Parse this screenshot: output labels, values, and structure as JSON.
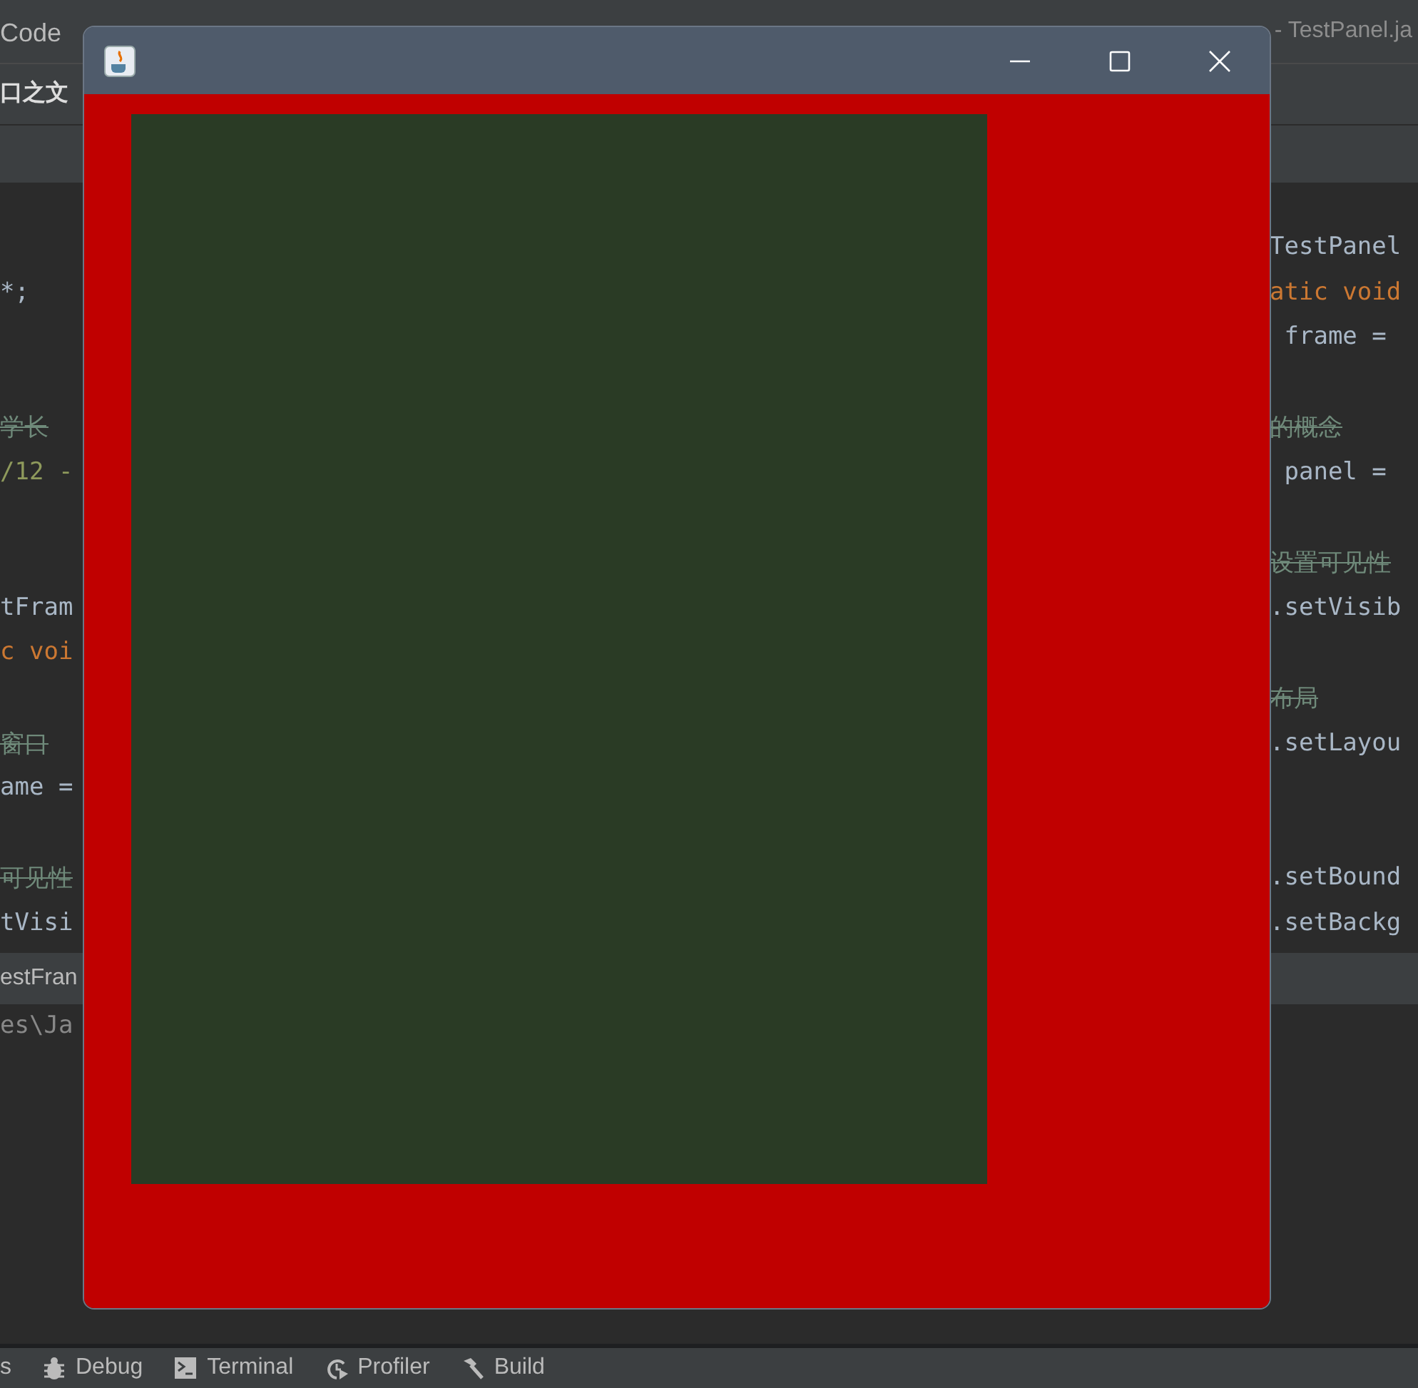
{
  "ide": {
    "menu": [
      {
        "label": "Code"
      }
    ],
    "title": "- TestPanel.ja",
    "editor_tab": "口之文",
    "left_lines": [
      {
        "kind": "blank"
      },
      {
        "kind": "code",
        "text": "*;"
      },
      {
        "kind": "blank"
      },
      {
        "kind": "blank"
      },
      {
        "kind": "comment",
        "text": "学长"
      },
      {
        "kind": "doc",
        "text": "/12 -"
      },
      {
        "kind": "blank"
      },
      {
        "kind": "blank"
      },
      {
        "kind": "code",
        "text": "tFram"
      },
      {
        "kind": "keyword",
        "text": "c voi"
      },
      {
        "kind": "blank"
      },
      {
        "kind": "comment",
        "text": "窗口"
      },
      {
        "kind": "code",
        "text": "ame ="
      },
      {
        "kind": "blank"
      },
      {
        "kind": "comment",
        "text": "可见性"
      },
      {
        "kind": "code",
        "text": "tVisi"
      }
    ],
    "right_lines": [
      {
        "kind": "code",
        "text": "TestPanel"
      },
      {
        "kind": "keyword",
        "text": "atic void"
      },
      {
        "kind": "code",
        "text": " frame ="
      },
      {
        "kind": "blank"
      },
      {
        "kind": "comment",
        "text": "的概念"
      },
      {
        "kind": "code",
        "text": " panel ="
      },
      {
        "kind": "blank"
      },
      {
        "kind": "comment",
        "text": "设置可见性"
      },
      {
        "kind": "code",
        "text": ".setVisib"
      },
      {
        "kind": "blank"
      },
      {
        "kind": "comment",
        "text": "布局"
      },
      {
        "kind": "code",
        "text": ".setLayou"
      },
      {
        "kind": "blank"
      },
      {
        "kind": "blank"
      },
      {
        "kind": "code",
        "text": ".setBound"
      },
      {
        "kind": "code",
        "text": ".setBackg"
      }
    ],
    "run_tab": "estFran",
    "console": "es\\Ja",
    "tool_tabs": [
      {
        "kind": "text",
        "label": "s"
      },
      {
        "kind": "debug",
        "label": "Debug"
      },
      {
        "kind": "terminal",
        "label": "Terminal"
      },
      {
        "kind": "profiler",
        "label": "Profiler"
      },
      {
        "kind": "build",
        "label": "Build"
      }
    ]
  }
}
